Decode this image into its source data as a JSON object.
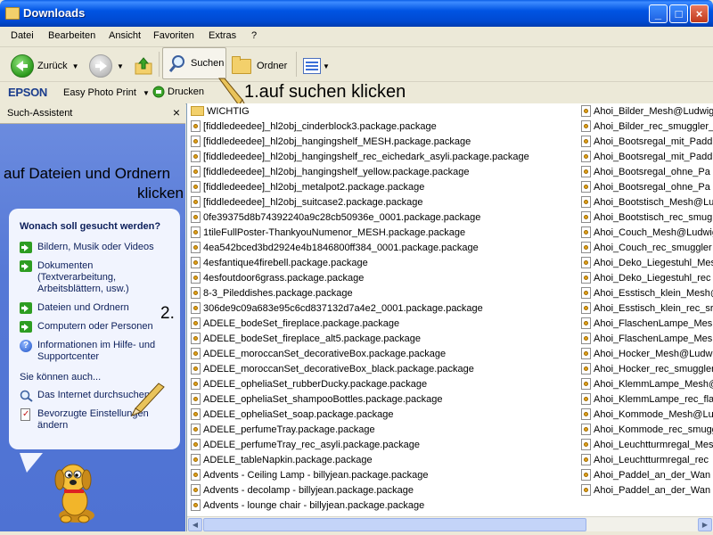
{
  "window": {
    "title": "Downloads"
  },
  "menu": [
    "Datei",
    "Bearbeiten",
    "Ansicht",
    "Favoriten",
    "Extras",
    "?"
  ],
  "toolbar": {
    "back_label": "Zurück",
    "search_label": "Suchen",
    "folders_label": "Ordner"
  },
  "epson": {
    "logo": "EPSON",
    "app_label": "Easy Photo Print",
    "print_label": "Drucken"
  },
  "annotations": {
    "step1": "1.auf suchen klicken",
    "side_line1": "auf Dateien und Ordnern",
    "side_line2": "klicken",
    "step2": "2."
  },
  "search_panel": {
    "header": "Such-Assistent",
    "close_glyph": "×",
    "question": "Wonach soll gesucht werden?",
    "options": [
      "Bildern, Musik oder Videos",
      "Dokumenten (Textverarbeitung, Arbeitsblättern, usw.)",
      "Dateien und Ordnern",
      "Computern oder Personen",
      "Informationen im Hilfe- und Supportcenter"
    ],
    "also_label": "Sie können auch...",
    "extra_options": [
      "Das Internet durchsuchen",
      "Bevorzugte Einstellungen ändern"
    ]
  },
  "files_left": [
    "WICHTIG",
    "[fiddledeedee]_hl2obj_cinderblock3.package.package",
    "[fiddledeedee]_hl2obj_hangingshelf_MESH.package.package",
    "[fiddledeedee]_hl2obj_hangingshelf_rec_eichedark_asyli.package.package",
    "[fiddledeedee]_hl2obj_hangingshelf_yellow.package.package",
    "[fiddledeedee]_hl2obj_metalpot2.package.package",
    "[fiddledeedee]_hl2obj_suitcase2.package.package",
    "0fe39375d8b74392240a9c28cb50936e_0001.package.package",
    "1tileFullPoster-ThankyouNumenor_MESH.package.package",
    "4ea542bced3bd2924e4b1846800ff384_0001.package.package",
    "4esfantique4firebell.package.package",
    "4esfoutdoor6grass.package.package",
    "8-3_Pileddishes.package.package",
    "306de9c09a683e95c6cd837132d7a4e2_0001.package.package",
    "ADELE_bodeSet_fireplace.package.package",
    "ADELE_bodeSet_fireplace_alt5.package.package",
    "ADELE_moroccanSet_decorativeBox.package.package",
    "ADELE_moroccanSet_decorativeBox_black.package.package",
    "ADELE_opheliaSet_rubberDucky.package.package",
    "ADELE_opheliaSet_shampooBottles.package.package",
    "ADELE_opheliaSet_soap.package.package",
    "ADELE_perfumeTray.package.package",
    "ADELE_perfumeTray_rec_asyli.package.package",
    "ADELE_tableNapkin.package.package",
    "Advents - Ceiling Lamp - billyjean.package.package",
    "Advents - decolamp - billyjean.package.package",
    "Advents - lounge chair - billyjean.package.package"
  ],
  "files_right": [
    "Ahoi_Bilder_Mesh@Ludwig",
    "Ahoi_Bilder_rec_smuggler_",
    "Ahoi_Bootsregal_mit_Padd",
    "Ahoi_Bootsregal_mit_Padd",
    "Ahoi_Bootsregal_ohne_Pa",
    "Ahoi_Bootsregal_ohne_Pa",
    "Ahoi_Bootstisch_Mesh@Lu",
    "Ahoi_Bootstisch_rec_smug",
    "Ahoi_Couch_Mesh@Ludwig",
    "Ahoi_Couch_rec_smuggler",
    "Ahoi_Deko_Liegestuhl_Mes",
    "Ahoi_Deko_Liegestuhl_rec",
    "Ahoi_Esstisch_klein_Mesh@",
    "Ahoi_Esstisch_klein_rec_sr",
    "Ahoi_FlaschenLampe_Mesh",
    "Ahoi_FlaschenLampe_Mesh",
    "Ahoi_Hocker_Mesh@Ludwi",
    "Ahoi_Hocker_rec_smuggler",
    "Ahoi_KlemmLampe_Mesh@",
    "Ahoi_KlemmLampe_rec_fla",
    "Ahoi_Kommode_Mesh@Lu",
    "Ahoi_Kommode_rec_smugg",
    "Ahoi_Leuchtturmregal_Mes",
    "Ahoi_Leuchtturmregal_rec",
    "Ahoi_Paddel_an_der_Wan",
    "Ahoi_Paddel_an_der_Wan"
  ]
}
